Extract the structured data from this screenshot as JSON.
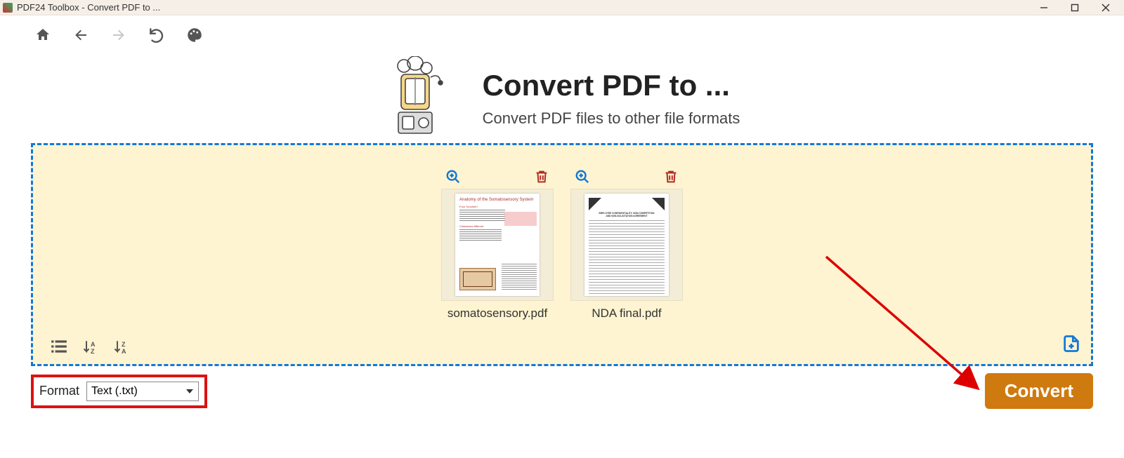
{
  "titlebar": {
    "title": "PDF24 Toolbox - Convert PDF to ..."
  },
  "hero": {
    "heading": "Convert PDF to ...",
    "sub": "Convert PDF files to other file formats"
  },
  "files": [
    {
      "name": "somatosensory.pdf"
    },
    {
      "name": "NDA final.pdf"
    }
  ],
  "footer": {
    "format_label": "Format",
    "format_value": "Text (.txt)",
    "convert_label": "Convert"
  }
}
